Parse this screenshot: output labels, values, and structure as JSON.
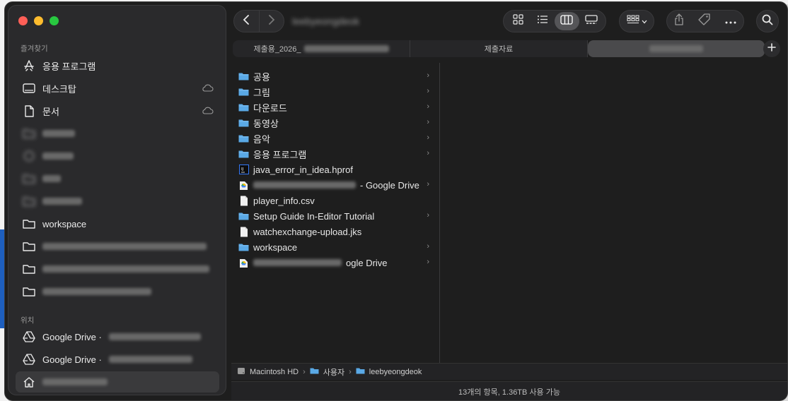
{
  "window": {
    "title": "leebyeongdeok"
  },
  "sidebar": {
    "favorites_label": "즐겨찾기",
    "favorites": [
      {
        "label": "응용 프로그램",
        "icon": "applications-icon"
      },
      {
        "label": "데스크탑",
        "icon": "desktop-icon",
        "cloud": true
      },
      {
        "label": "문서",
        "icon": "document-icon",
        "cloud": true
      },
      {
        "label": "",
        "icon": "folder-icon"
      },
      {
        "label": "",
        "icon": "download-icon"
      },
      {
        "label": "",
        "icon": "folder-icon"
      },
      {
        "label": "",
        "icon": "folder-icon"
      },
      {
        "label": "workspace",
        "icon": "folder-icon"
      },
      {
        "label": "",
        "icon": "folder-icon"
      },
      {
        "label": "",
        "icon": "folder-icon"
      },
      {
        "label": "",
        "icon": "folder-icon"
      }
    ],
    "locations_label": "위치",
    "locations": [
      {
        "label": "Google Drive ·",
        "icon": "google-drive-icon"
      },
      {
        "label": "Google Drive ·",
        "icon": "google-drive-icon"
      },
      {
        "label": "",
        "icon": "home-icon",
        "selected": true
      }
    ]
  },
  "toolbar": {
    "back": "back-icon",
    "forward": "forward-icon",
    "views": [
      "icon-view",
      "list-view",
      "column-view",
      "gallery-view"
    ],
    "active_view": "column-view"
  },
  "tabs": [
    {
      "label": "제출용_2026_"
    },
    {
      "label": "제출자료"
    },
    {
      "label": ""
    }
  ],
  "files": [
    {
      "name": "공용",
      "type": "folder",
      "chevron": true
    },
    {
      "name": "그림",
      "type": "folder",
      "chevron": true
    },
    {
      "name": "다운로드",
      "type": "folder",
      "chevron": true
    },
    {
      "name": "동영상",
      "type": "folder",
      "chevron": true
    },
    {
      "name": "음악",
      "type": "folder",
      "chevron": true
    },
    {
      "name": "응용 프로그램",
      "type": "folder",
      "chevron": true
    },
    {
      "name": "java_error_in_idea.hprof",
      "type": "hprof",
      "chevron": false
    },
    {
      "name": "- Google Drive",
      "type": "gdrive",
      "chevron": true
    },
    {
      "name": "player_info.csv",
      "type": "file",
      "chevron": false
    },
    {
      "name": "Setup Guide In-Editor Tutorial",
      "type": "folder",
      "chevron": true
    },
    {
      "name": "watchexchange-upload.jks",
      "type": "file",
      "chevron": false
    },
    {
      "name": "workspace",
      "type": "folder",
      "chevron": true
    },
    {
      "name": "ogle Drive",
      "type": "gdrive",
      "chevron": true
    }
  ],
  "pathbar": {
    "segments": [
      "Macintosh HD",
      "사용자",
      "leebyeongdeok"
    ]
  },
  "status": {
    "text": "13개의 항목, 1.36TB 사용 가능"
  },
  "colors": {
    "folder": "#5aa9e6",
    "accent_red": "#ff5f57",
    "accent_yellow": "#febc2e",
    "accent_green": "#28c840"
  }
}
